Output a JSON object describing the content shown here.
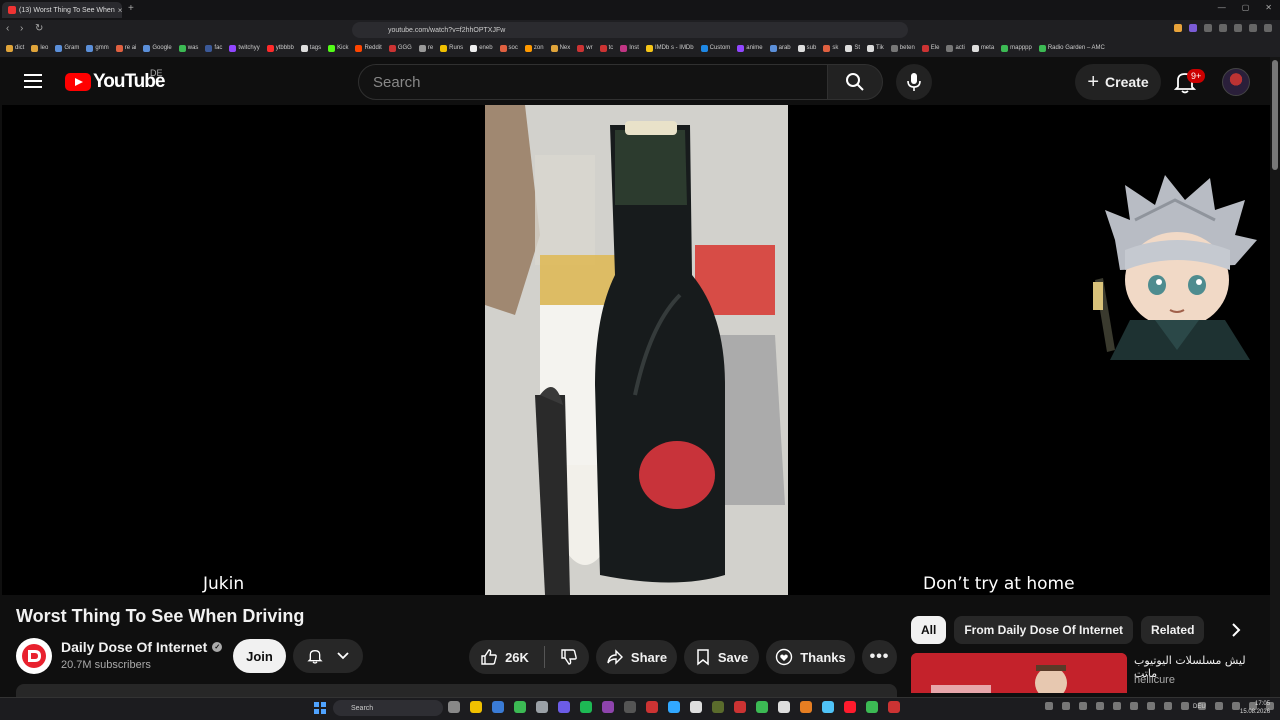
{
  "browser": {
    "tab_title": "(13) Worst Thing To See When",
    "tab_close": "×",
    "new_tab": "+",
    "url": "youtube.com/watch?v=f2hhOPTXJFw",
    "window_controls": [
      "—",
      "▢",
      "✕"
    ],
    "bookmarks": [
      {
        "label": "dict",
        "color": "#e0a43a"
      },
      {
        "label": "leo",
        "color": "#e0a43a"
      },
      {
        "label": "Gram",
        "color": "#5b8fd9"
      },
      {
        "label": "gmm",
        "color": "#5b8fd9"
      },
      {
        "label": "re ai",
        "color": "#e06040"
      },
      {
        "label": "Google",
        "color": "#5b8fd9"
      },
      {
        "label": "was",
        "color": "#3cba54"
      },
      {
        "label": "fac",
        "color": "#3b5998"
      },
      {
        "label": "twitchyy",
        "color": "#9146ff"
      },
      {
        "label": "ytbbbb",
        "color": "#ff2a2a"
      },
      {
        "label": "tags",
        "color": "#dddddd"
      },
      {
        "label": "Kick",
        "color": "#53fc18"
      },
      {
        "label": "Reddit",
        "color": "#ff4500"
      },
      {
        "label": "GGG",
        "color": "#cc3333"
      },
      {
        "label": "re",
        "color": "#999999"
      },
      {
        "label": "Runs",
        "color": "#f0c000"
      },
      {
        "label": "eneb",
        "color": "#eeeeee"
      },
      {
        "label": "soc",
        "color": "#e06040"
      },
      {
        "label": "zon",
        "color": "#ff9900"
      },
      {
        "label": "Nex",
        "color": "#e0a43a"
      },
      {
        "label": "wr",
        "color": "#cc3333"
      },
      {
        "label": "tc",
        "color": "#cc3333"
      },
      {
        "label": "Inst",
        "color": "#c13584"
      },
      {
        "label": "IMDb s - IMDb",
        "color": "#f5c518"
      },
      {
        "label": "Custom",
        "color": "#1e88e5"
      },
      {
        "label": "anime",
        "color": "#9146ff"
      },
      {
        "label": "arab",
        "color": "#5b8fd9"
      },
      {
        "label": "sub",
        "color": "#dddddd"
      },
      {
        "label": "sk",
        "color": "#e06040"
      },
      {
        "label": "St",
        "color": "#dddddd"
      },
      {
        "label": "Tik",
        "color": "#dddddd"
      },
      {
        "label": "beten",
        "color": "#777777"
      },
      {
        "label": "Ele",
        "color": "#cc3333"
      },
      {
        "label": "acti",
        "color": "#777777"
      },
      {
        "label": "meta",
        "color": "#dddddd"
      },
      {
        "label": "mapppp",
        "color": "#3cba54"
      },
      {
        "label": "Radio Garden – AMC",
        "color": "#3cba54"
      }
    ]
  },
  "youtube": {
    "logo_text": "YouTube",
    "country_code": "DE",
    "search_placeholder": "Search",
    "create_label": "Create",
    "notification_count": "9+",
    "video": {
      "caption_left": "Jukin",
      "caption_right": "Don’t try at home",
      "title": "Worst Thing To See When Driving"
    },
    "channel": {
      "name": "Daily Dose Of Internet",
      "verified_mark": "✓",
      "subscribers": "20.7M subscribers",
      "join_label": "Join"
    },
    "actions": {
      "likes": "26K",
      "share": "Share",
      "save": "Save",
      "thanks": "Thanks"
    },
    "chips": [
      {
        "label": "All",
        "active": true
      },
      {
        "label": "From Daily Dose Of Internet",
        "active": false
      },
      {
        "label": "Related",
        "active": false
      }
    ],
    "recommendation": {
      "title": "ليش مسلسلات اليوتيوب ماتت",
      "channel": "hellicure"
    }
  },
  "taskbar": {
    "search_label": "Search",
    "language": "DEU",
    "time": "17:05",
    "date": "15.08.2026",
    "icon_colors": [
      "#888888",
      "#f0c000",
      "#3a7bd5",
      "#3cba54",
      "#9aa0a6",
      "#6c5ce7",
      "#1db954",
      "#8e44ad",
      "#555555",
      "#cc3333",
      "#31a8ff",
      "#dddddd",
      "#5a6b2c",
      "#cc3333",
      "#3cba54",
      "#dddddd",
      "#e67e22",
      "#4fc3f7",
      "#ff1b2d",
      "#3cba54",
      "#cc3333"
    ]
  }
}
